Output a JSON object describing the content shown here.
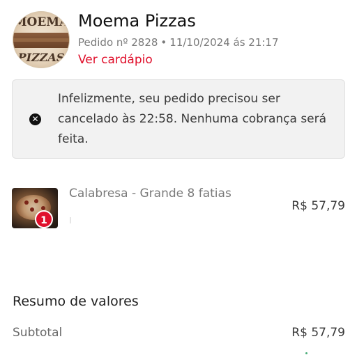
{
  "header": {
    "logo_text_top": "MOEMA",
    "logo_text_bottom": "PIZZAS",
    "store_name": "Moema Pizzas",
    "order_number": "Pedido nº 2828",
    "separator": "•",
    "order_datetime": "11/10/2024 ás 21:17",
    "menu_link": "Ver cardápio"
  },
  "alert": {
    "icon": "close-circle-icon",
    "message": "Infelizmente, seu pedido precisou ser cancelado às 22:58. Nenhuma cobrança será feita."
  },
  "items": [
    {
      "name": "Calabresa - Grande 8 fatias",
      "quantity": "1",
      "price": "R$ 57,79",
      "thumb_icon": "pizza-image"
    }
  ],
  "summary": {
    "title": "Resumo de valores",
    "rows": [
      {
        "label": "Subtotal",
        "value": "R$ 57,79"
      }
    ]
  },
  "colors": {
    "accent": "#e0102c",
    "alert_bg": "#f2f2f2",
    "text": "#3a3a3a"
  }
}
